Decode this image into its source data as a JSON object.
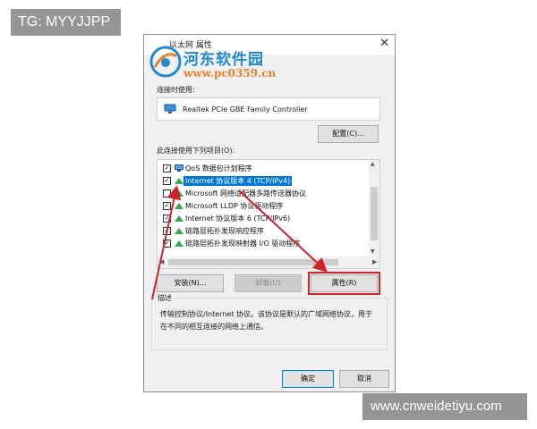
{
  "overlay_tag": "TG: MYYJJPP",
  "footer_watermark": "www.cnweidetiyu.com",
  "watermark": {
    "brand": "河东软件园",
    "url": "www.pc0359.cn"
  },
  "dialog": {
    "title": "以太网 属性",
    "connect_using_label": "连接时使用:",
    "adapter_name": "Realtek PCIe GBE Family Controller",
    "configure_button": "配置(C)...",
    "items_label": "此连接使用下列项目(O):",
    "items": [
      {
        "label": "QoS 数据包计划程序",
        "checked": true,
        "icon": "qos-icon"
      },
      {
        "label": "Internet 协议版本 4 (TCP/IPv4)",
        "checked": true,
        "icon": "protocol-icon",
        "selected": true
      },
      {
        "label": "Microsoft 网络适配器多路传送器协议",
        "checked": false,
        "icon": "protocol-icon"
      },
      {
        "label": "Microsoft LLDP 协议驱动程序",
        "checked": true,
        "icon": "protocol-icon"
      },
      {
        "label": "Internet 协议版本 6 (TCP/IPv6)",
        "checked": true,
        "icon": "protocol-icon"
      },
      {
        "label": "链路层拓扑发现响应程序",
        "checked": true,
        "icon": "protocol-icon"
      },
      {
        "label": "链路层拓扑发现映射器 I/O 驱动程序",
        "checked": true,
        "icon": "protocol-icon"
      }
    ],
    "install_button": "安装(N)...",
    "uninstall_button": "卸载(U)",
    "properties_button": "属性(R)",
    "description_title": "描述",
    "description_text": "传输控制协议/Internet 协议。该协议是默认的广域网络协议，用于在不同的相互连接的网络上通信。",
    "ok_button": "确定",
    "cancel_button": "取消"
  },
  "colors": {
    "selection": "#0078d7",
    "annotation": "#d2232a",
    "watermark_blue": "#1f8ad0",
    "watermark_orange": "#e5822e"
  }
}
